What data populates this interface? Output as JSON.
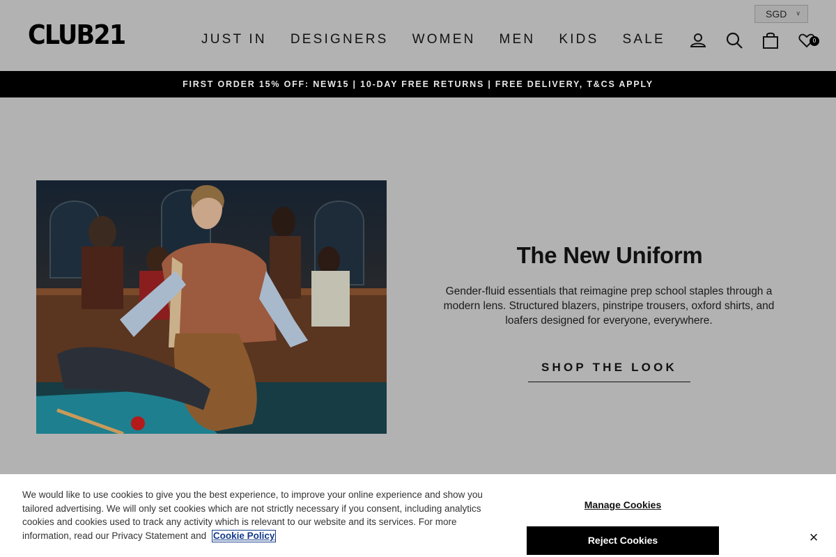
{
  "header": {
    "logo": "CLUB21",
    "currency": "SGD",
    "nav": [
      {
        "label": "JUST IN"
      },
      {
        "label": "DESIGNERS"
      },
      {
        "label": "WOMEN"
      },
      {
        "label": "MEN"
      },
      {
        "label": "KIDS"
      },
      {
        "label": "SALE"
      }
    ],
    "wishlist_count": "0",
    "icons": [
      "user-icon",
      "search-icon",
      "shopping-bag-icon",
      "wishlist-heart-icon"
    ]
  },
  "promo": {
    "text": "FIRST ORDER 15% OFF: NEW15 | 10-DAY FREE RETURNS | FREE DELIVERY, T&CS APPLY"
  },
  "hero": {
    "title": "The New Uniform",
    "description": "Gender-fluid essentials that reimagine prep school staples through a modern lens. Structured blazers, pinstripe trousers, oxford shirts, and loafers designed for everyone, everywhere.",
    "cta": "SHOP THE LOOK"
  },
  "cookie": {
    "text": "We would like to use cookies to give you the best experience, to improve your online experience and show you tailored advertising. We will only set cookies which are not strictly necessary if you consent, including analytics cookies and cookies used to track any activity which is relevant to our website and its services. For more information, read our Privacy Statement and",
    "link": "Cookie Policy",
    "manage": "Manage Cookies",
    "reject": "Reject Cookies",
    "close": "×"
  },
  "colors": {
    "overlay_background": "#b2b2b2",
    "promo_background": "#000000",
    "cookie_link": "#113a8a"
  }
}
